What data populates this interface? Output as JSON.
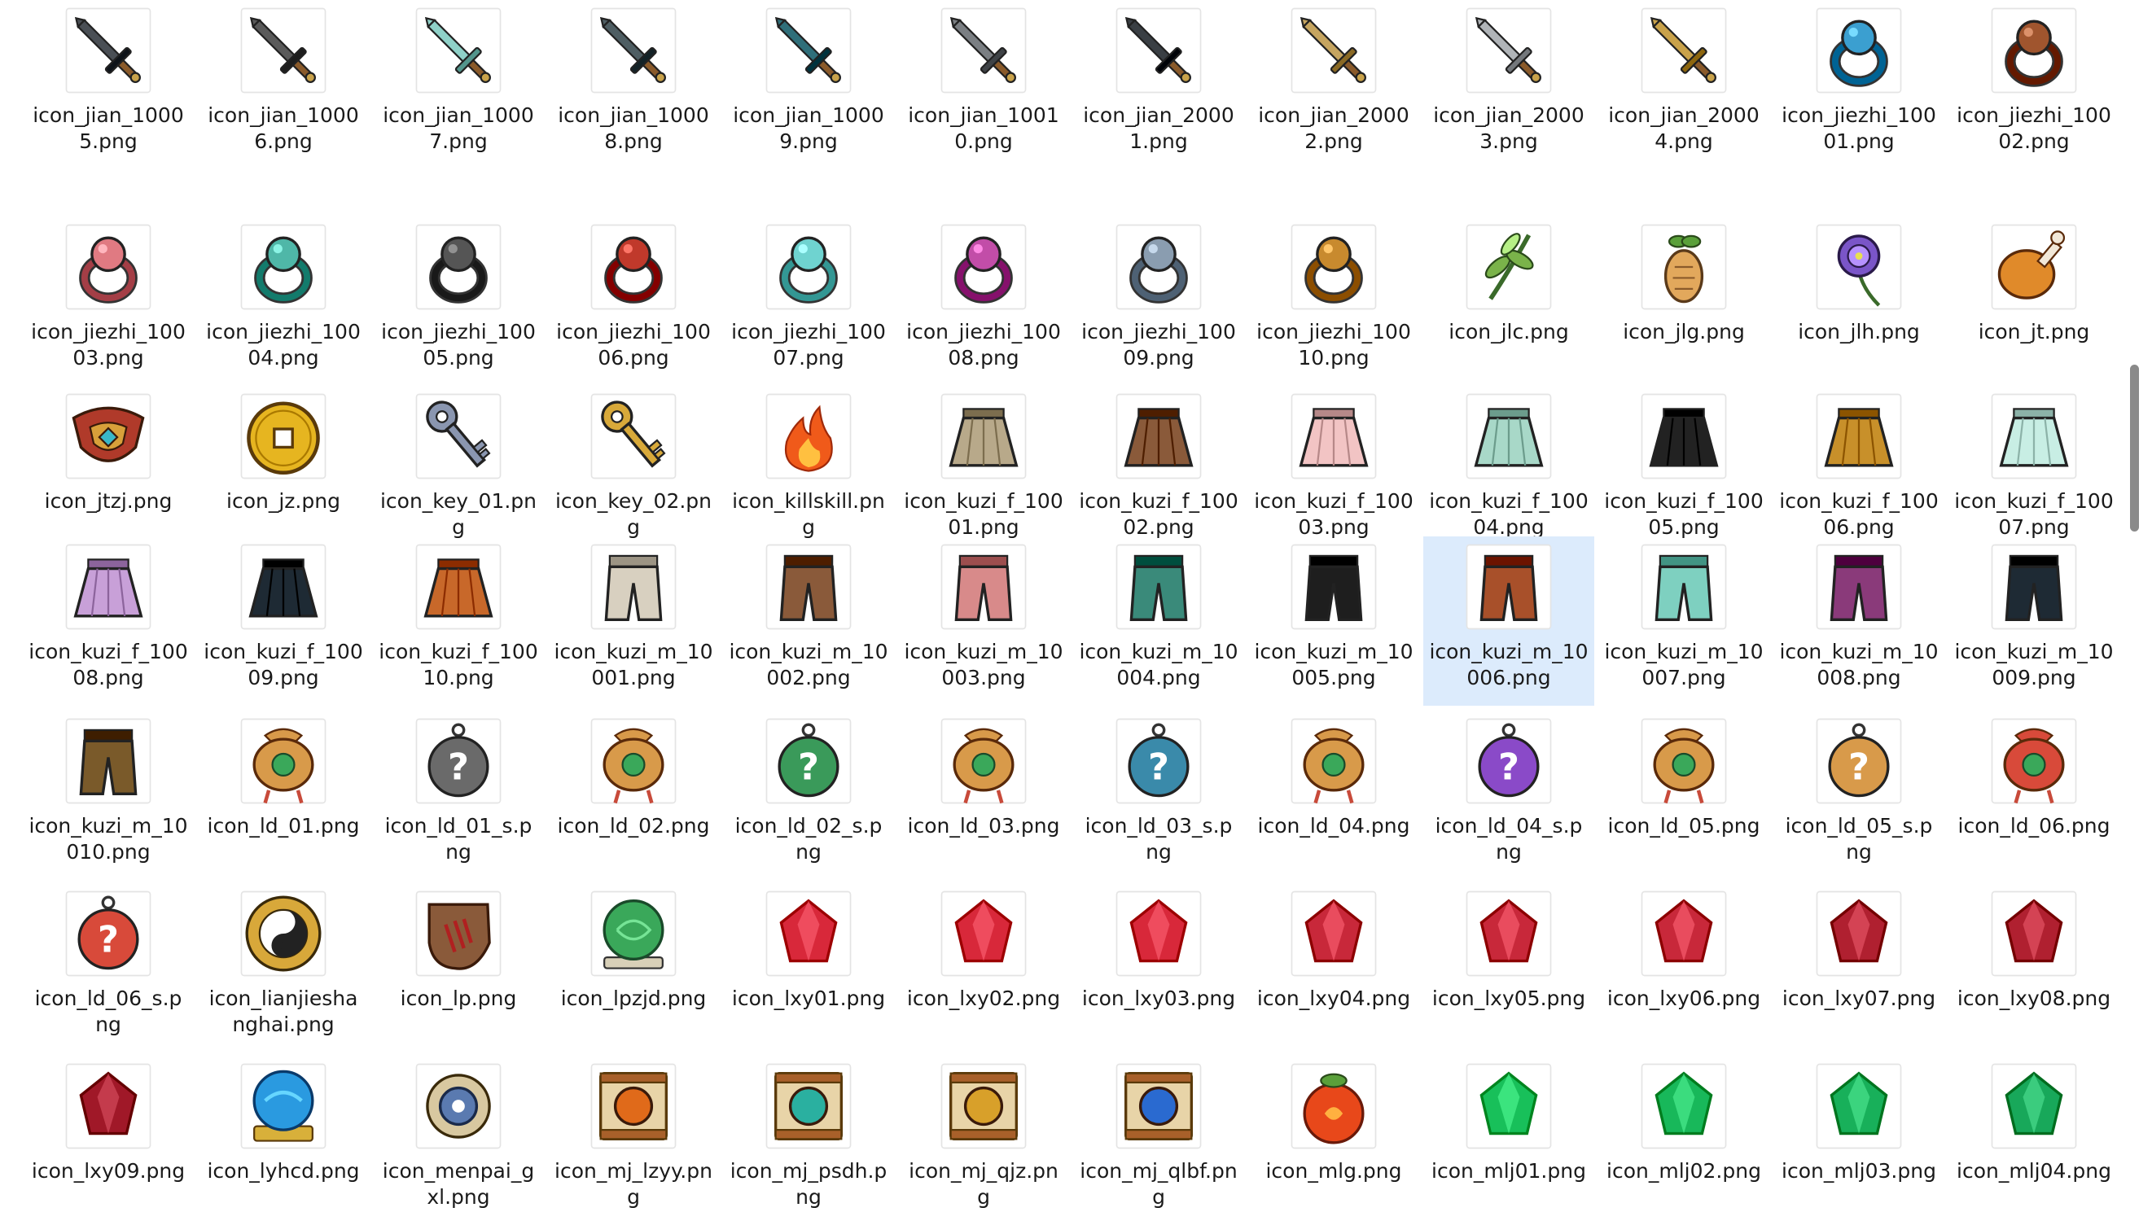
{
  "colors": {
    "selection_bg": "#dcebfc",
    "scroll_thumb": "#8a8a8a",
    "text": "#1a1a1a"
  },
  "explorer": {
    "selected_file": "icon_kuzi_m_10006.png",
    "files": [
      {
        "name": "icon_jian_10005.png",
        "icon": "sword-icon",
        "color": "#4a4f55"
      },
      {
        "name": "icon_jian_10006.png",
        "icon": "sword-icon",
        "color": "#5a5a5a"
      },
      {
        "name": "icon_jian_10007.png",
        "icon": "sword-icon",
        "color": "#8fd1c8"
      },
      {
        "name": "icon_jian_10008.png",
        "icon": "sword-icon",
        "color": "#4f5e63"
      },
      {
        "name": "icon_jian_10009.png",
        "icon": "sword-icon",
        "color": "#2f6f7a"
      },
      {
        "name": "icon_jian_10010.png",
        "icon": "sword-icon",
        "color": "#7b7f83"
      },
      {
        "name": "icon_jian_20001.png",
        "icon": "sword-icon",
        "color": "#3a3f44"
      },
      {
        "name": "icon_jian_20002.png",
        "icon": "sword-icon",
        "color": "#c6a560"
      },
      {
        "name": "icon_jian_20003.png",
        "icon": "sword-icon",
        "color": "#b0b4b8"
      },
      {
        "name": "icon_jian_20004.png",
        "icon": "sword-icon",
        "color": "#c9a24a"
      },
      {
        "name": "icon_jiezhi_10001.png",
        "icon": "ring-icon",
        "color": "#3b9fd0"
      },
      {
        "name": "icon_jiezhi_10002.png",
        "icon": "ring-icon",
        "color": "#a0552e"
      },
      {
        "name": "icon_jiezhi_10003.png",
        "icon": "ring-icon",
        "color": "#e07a82"
      },
      {
        "name": "icon_jiezhi_10004.png",
        "icon": "ring-icon",
        "color": "#4fb7a8"
      },
      {
        "name": "icon_jiezhi_10005.png",
        "icon": "ring-icon",
        "color": "#555555"
      },
      {
        "name": "icon_jiezhi_10006.png",
        "icon": "ring-icon",
        "color": "#c0392b"
      },
      {
        "name": "icon_jiezhi_10007.png",
        "icon": "ring-icon",
        "color": "#6fd3d0"
      },
      {
        "name": "icon_jiezhi_10008.png",
        "icon": "ring-icon",
        "color": "#c24da8"
      },
      {
        "name": "icon_jiezhi_10009.png",
        "icon": "ring-icon",
        "color": "#8a9db0"
      },
      {
        "name": "icon_jiezhi_10010.png",
        "icon": "ring-icon",
        "color": "#c88a2e"
      },
      {
        "name": "icon_jlc.png",
        "icon": "herb-icon",
        "color": "#7ab34a"
      },
      {
        "name": "icon_jlg.png",
        "icon": "root-icon",
        "color": "#e2a85c"
      },
      {
        "name": "icon_jlh.png",
        "icon": "flower-icon",
        "color": "#7a55c8"
      },
      {
        "name": "icon_jt.png",
        "icon": "drumstick-icon",
        "color": "#e08a2a"
      },
      {
        "name": "icon_jtzj.png",
        "icon": "armor-icon",
        "color": "#b03a2a"
      },
      {
        "name": "icon_jz.png",
        "icon": "coin-icon",
        "color": "#e6b520"
      },
      {
        "name": "icon_key_01.png",
        "icon": "key-icon",
        "color": "#8a96b0"
      },
      {
        "name": "icon_key_02.png",
        "icon": "key-icon",
        "color": "#d8a93a"
      },
      {
        "name": "icon_killskill.png",
        "icon": "flame-icon",
        "color": "#f05a1a"
      },
      {
        "name": "icon_kuzi_f_10001.png",
        "icon": "skirt-icon",
        "color": "#b8a98a"
      },
      {
        "name": "icon_kuzi_f_10002.png",
        "icon": "skirt-icon",
        "color": "#8a5a3a"
      },
      {
        "name": "icon_kuzi_f_10003.png",
        "icon": "skirt-icon",
        "color": "#f2c4c4"
      },
      {
        "name": "icon_kuzi_f_10004.png",
        "icon": "skirt-icon",
        "color": "#a8d8c8"
      },
      {
        "name": "icon_kuzi_f_10005.png",
        "icon": "skirt-icon",
        "color": "#222222"
      },
      {
        "name": "icon_kuzi_f_10006.png",
        "icon": "skirt-icon",
        "color": "#c8902a"
      },
      {
        "name": "icon_kuzi_f_10007.png",
        "icon": "skirt-icon",
        "color": "#c8eee4"
      },
      {
        "name": "icon_kuzi_f_10008.png",
        "icon": "skirt-icon",
        "color": "#c8a0d8"
      },
      {
        "name": "icon_kuzi_f_10009.png",
        "icon": "skirt-icon",
        "color": "#1e2a34"
      },
      {
        "name": "icon_kuzi_f_10010.png",
        "icon": "skirt-icon",
        "color": "#c8682a"
      },
      {
        "name": "icon_kuzi_m_10001.png",
        "icon": "pants-icon",
        "color": "#d8d0c0"
      },
      {
        "name": "icon_kuzi_m_10002.png",
        "icon": "pants-icon",
        "color": "#8a5a3a"
      },
      {
        "name": "icon_kuzi_m_10003.png",
        "icon": "pants-icon",
        "color": "#d88a8a"
      },
      {
        "name": "icon_kuzi_m_10004.png",
        "icon": "pants-icon",
        "color": "#3a8a7a"
      },
      {
        "name": "icon_kuzi_m_10005.png",
        "icon": "pants-icon",
        "color": "#1e1e1e"
      },
      {
        "name": "icon_kuzi_m_10006.png",
        "icon": "pants-icon",
        "color": "#a8502a"
      },
      {
        "name": "icon_kuzi_m_10007.png",
        "icon": "pants-icon",
        "color": "#7ed0c0"
      },
      {
        "name": "icon_kuzi_m_10008.png",
        "icon": "pants-icon",
        "color": "#8a3a7a"
      },
      {
        "name": "icon_kuzi_m_10009.png",
        "icon": "pants-icon",
        "color": "#1e2a34"
      },
      {
        "name": "icon_kuzi_m_10010.png",
        "icon": "pants-icon",
        "color": "#7a5a2a"
      },
      {
        "name": "icon_ld_01.png",
        "icon": "lucky-bag-icon",
        "color": "#d89a4a"
      },
      {
        "name": "icon_ld_01_s.png",
        "icon": "mystery-bag-icon",
        "color": "#6a6a6a"
      },
      {
        "name": "icon_ld_02.png",
        "icon": "lucky-bag-icon",
        "color": "#d89a4a"
      },
      {
        "name": "icon_ld_02_s.png",
        "icon": "mystery-bag-icon",
        "color": "#3a9a5a"
      },
      {
        "name": "icon_ld_03.png",
        "icon": "lucky-bag-icon",
        "color": "#d89a4a"
      },
      {
        "name": "icon_ld_03_s.png",
        "icon": "mystery-bag-icon",
        "color": "#3a8aaa"
      },
      {
        "name": "icon_ld_04.png",
        "icon": "lucky-bag-icon",
        "color": "#d89a4a"
      },
      {
        "name": "icon_ld_04_s.png",
        "icon": "mystery-bag-icon",
        "color": "#8a4ac8"
      },
      {
        "name": "icon_ld_05.png",
        "icon": "lucky-bag-icon",
        "color": "#d89a4a"
      },
      {
        "name": "icon_ld_05_s.png",
        "icon": "mystery-bag-icon",
        "color": "#d89a4a"
      },
      {
        "name": "icon_ld_06.png",
        "icon": "lucky-bag-icon",
        "color": "#d84a3a"
      },
      {
        "name": "icon_ld_06_s.png",
        "icon": "mystery-bag-icon",
        "color": "#d84a3a"
      },
      {
        "name": "icon_lianjieshanghai.png",
        "icon": "taiji-medal-icon",
        "color": "#d8a83a"
      },
      {
        "name": "icon_lp.png",
        "icon": "torn-hide-icon",
        "color": "#8a5a3a"
      },
      {
        "name": "icon_lpzjd.png",
        "icon": "green-orb-icon",
        "color": "#3aa85a"
      },
      {
        "name": "icon_lxy01.png",
        "icon": "red-gem-icon",
        "color": "#d8283a"
      },
      {
        "name": "icon_lxy02.png",
        "icon": "red-gem-icon",
        "color": "#d8283a"
      },
      {
        "name": "icon_lxy03.png",
        "icon": "red-gem-icon",
        "color": "#d8283a"
      },
      {
        "name": "icon_lxy04.png",
        "icon": "red-gem-icon",
        "color": "#c8283a"
      },
      {
        "name": "icon_lxy05.png",
        "icon": "red-gem-icon",
        "color": "#c8283a"
      },
      {
        "name": "icon_lxy06.png",
        "icon": "red-gem-icon",
        "color": "#c8283a"
      },
      {
        "name": "icon_lxy07.png",
        "icon": "red-gem-icon",
        "color": "#b02030"
      },
      {
        "name": "icon_lxy08.png",
        "icon": "red-gem-icon",
        "color": "#b02030"
      },
      {
        "name": "icon_lxy09.png",
        "icon": "red-gem-icon",
        "color": "#a01828"
      },
      {
        "name": "icon_lyhcd.png",
        "icon": "crystal-ball-icon",
        "color": "#2a9ae0"
      },
      {
        "name": "icon_menpai_gxl.png",
        "icon": "jade-pendant-icon",
        "color": "#5a7ab0"
      },
      {
        "name": "icon_mj_lzyy.png",
        "icon": "scroll-book-icon",
        "color": "#e06a1a"
      },
      {
        "name": "icon_mj_psdh.png",
        "icon": "scroll-book-icon",
        "color": "#2ab0a0"
      },
      {
        "name": "icon_mj_qjz.png",
        "icon": "scroll-book-icon",
        "color": "#d8a02a"
      },
      {
        "name": "icon_mj_qlbf.png",
        "icon": "scroll-book-icon",
        "color": "#2a6ad0"
      },
      {
        "name": "icon_mlg.png",
        "icon": "fruit-icon",
        "color": "#e8481a"
      },
      {
        "name": "icon_mlj01.png",
        "icon": "green-gem-icon",
        "color": "#18c05a"
      },
      {
        "name": "icon_mlj02.png",
        "icon": "green-gem-icon",
        "color": "#18b85a"
      },
      {
        "name": "icon_mlj03.png",
        "icon": "green-gem-icon",
        "color": "#18b05a"
      },
      {
        "name": "icon_mlj04.png",
        "icon": "green-gem-icon",
        "color": "#18a85a"
      }
    ]
  }
}
